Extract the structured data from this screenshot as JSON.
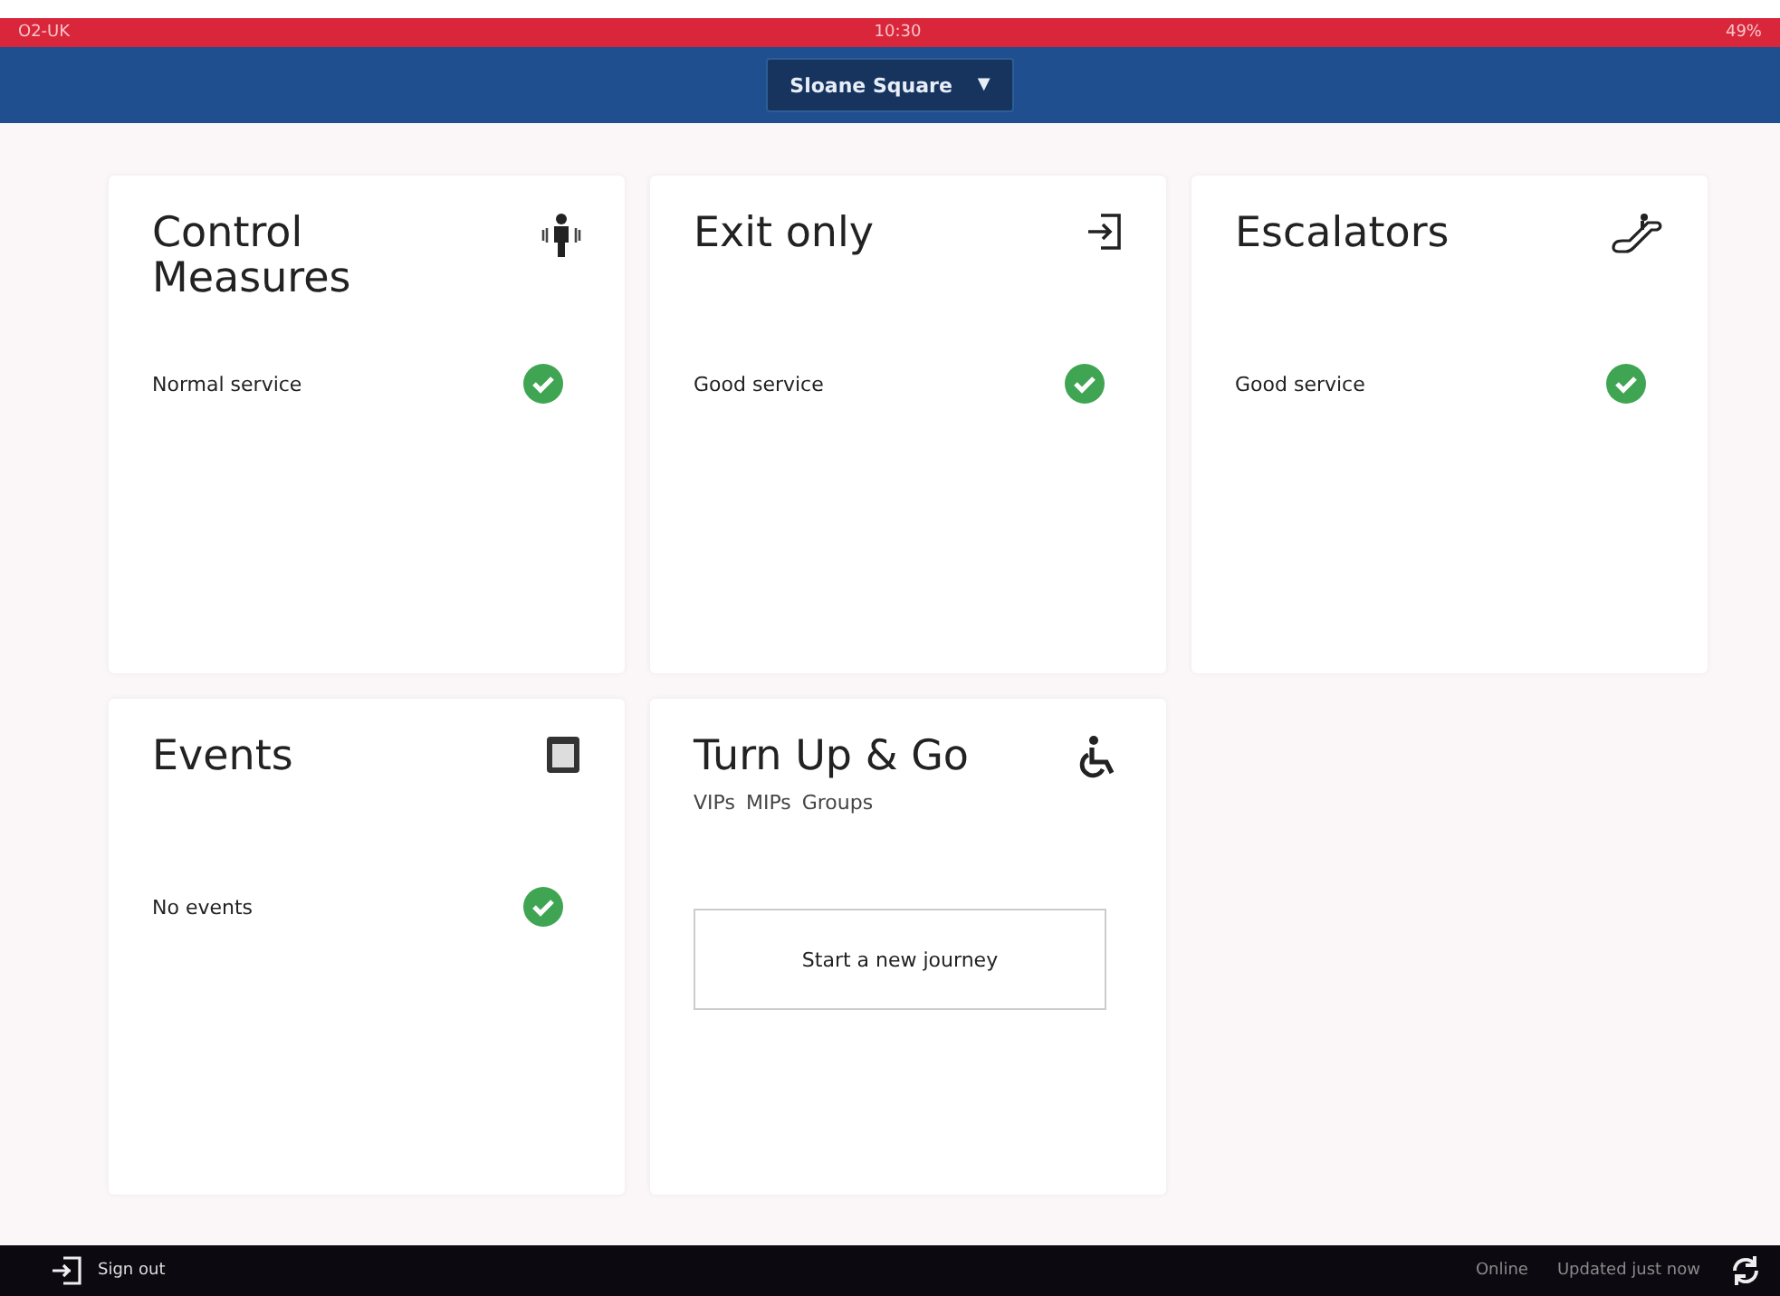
{
  "status_bar": {
    "carrier": "O2-UK",
    "time": "10:30",
    "battery": "49%"
  },
  "header": {
    "station": "Sloane Square",
    "dropdown_glyph": "▼"
  },
  "cards": [
    {
      "kind": "status",
      "title": "Control Measures",
      "status": "Normal service"
    },
    {
      "kind": "status",
      "title": "Exit only",
      "status": "Good service"
    },
    {
      "kind": "status",
      "title": "Escalators",
      "status": "Good service"
    },
    {
      "kind": "status",
      "title": "Events",
      "status": "No events"
    },
    {
      "kind": "journey",
      "title": "Turn Up & Go",
      "subtitles": [
        "VIPs",
        "MIPs",
        "Groups"
      ],
      "button": "Start a new journey"
    }
  ],
  "footer": {
    "sign_out": "Sign out",
    "connection": "Online",
    "updated": "Updated just now"
  }
}
